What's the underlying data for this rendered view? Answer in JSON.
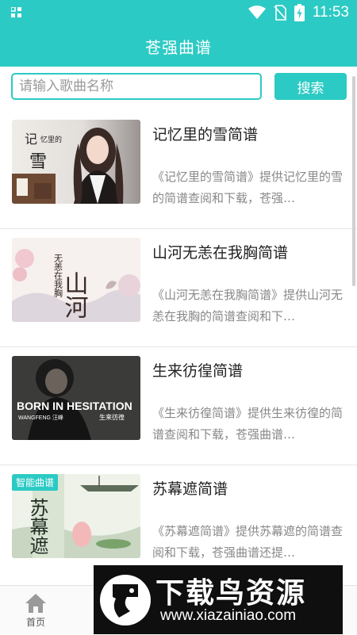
{
  "status_bar": {
    "time": "11:53"
  },
  "app": {
    "title": "苍强曲谱"
  },
  "search": {
    "placeholder": "请输入歌曲名称",
    "button_label": "搜索"
  },
  "songs": [
    {
      "title": "记忆里的雪简谱",
      "description": "《记忆里的雪简谱》提供记忆里的雪的简谱查阅和下载，苍强…",
      "tag": ""
    },
    {
      "title": "山河无恙在我胸简谱",
      "description": "《山河无恙在我胸简谱》提供山河无恙在我胸的简谱查阅和下…",
      "tag": ""
    },
    {
      "title": "生来彷徨简谱",
      "description": "《生来彷徨简谱》提供生来彷徨的简谱查阅和下载，苍强曲谱…",
      "tag": ""
    },
    {
      "title": "苏幕遮简谱",
      "description": "《苏幕遮简谱》提供苏幕遮的简谱查阅和下载，苍强曲谱还提…",
      "tag": "智能曲谱"
    }
  ],
  "thumb_text": {
    "t1_big": "记",
    "t1_small": "忆里的",
    "t1_snow": "雪",
    "t2_big": "山河",
    "t2_side": "无恙在我胸",
    "t3_main": "BORN IN HESITATION",
    "t3_sub": "WANGFENG 汪峰",
    "t3_cn": "生来彷徨",
    "t4_big": "苏幕遮"
  },
  "tabbar": {
    "home_label": "首页"
  },
  "watermark": {
    "title": "下载鸟资源",
    "url": "www.xiazainiao.com"
  }
}
